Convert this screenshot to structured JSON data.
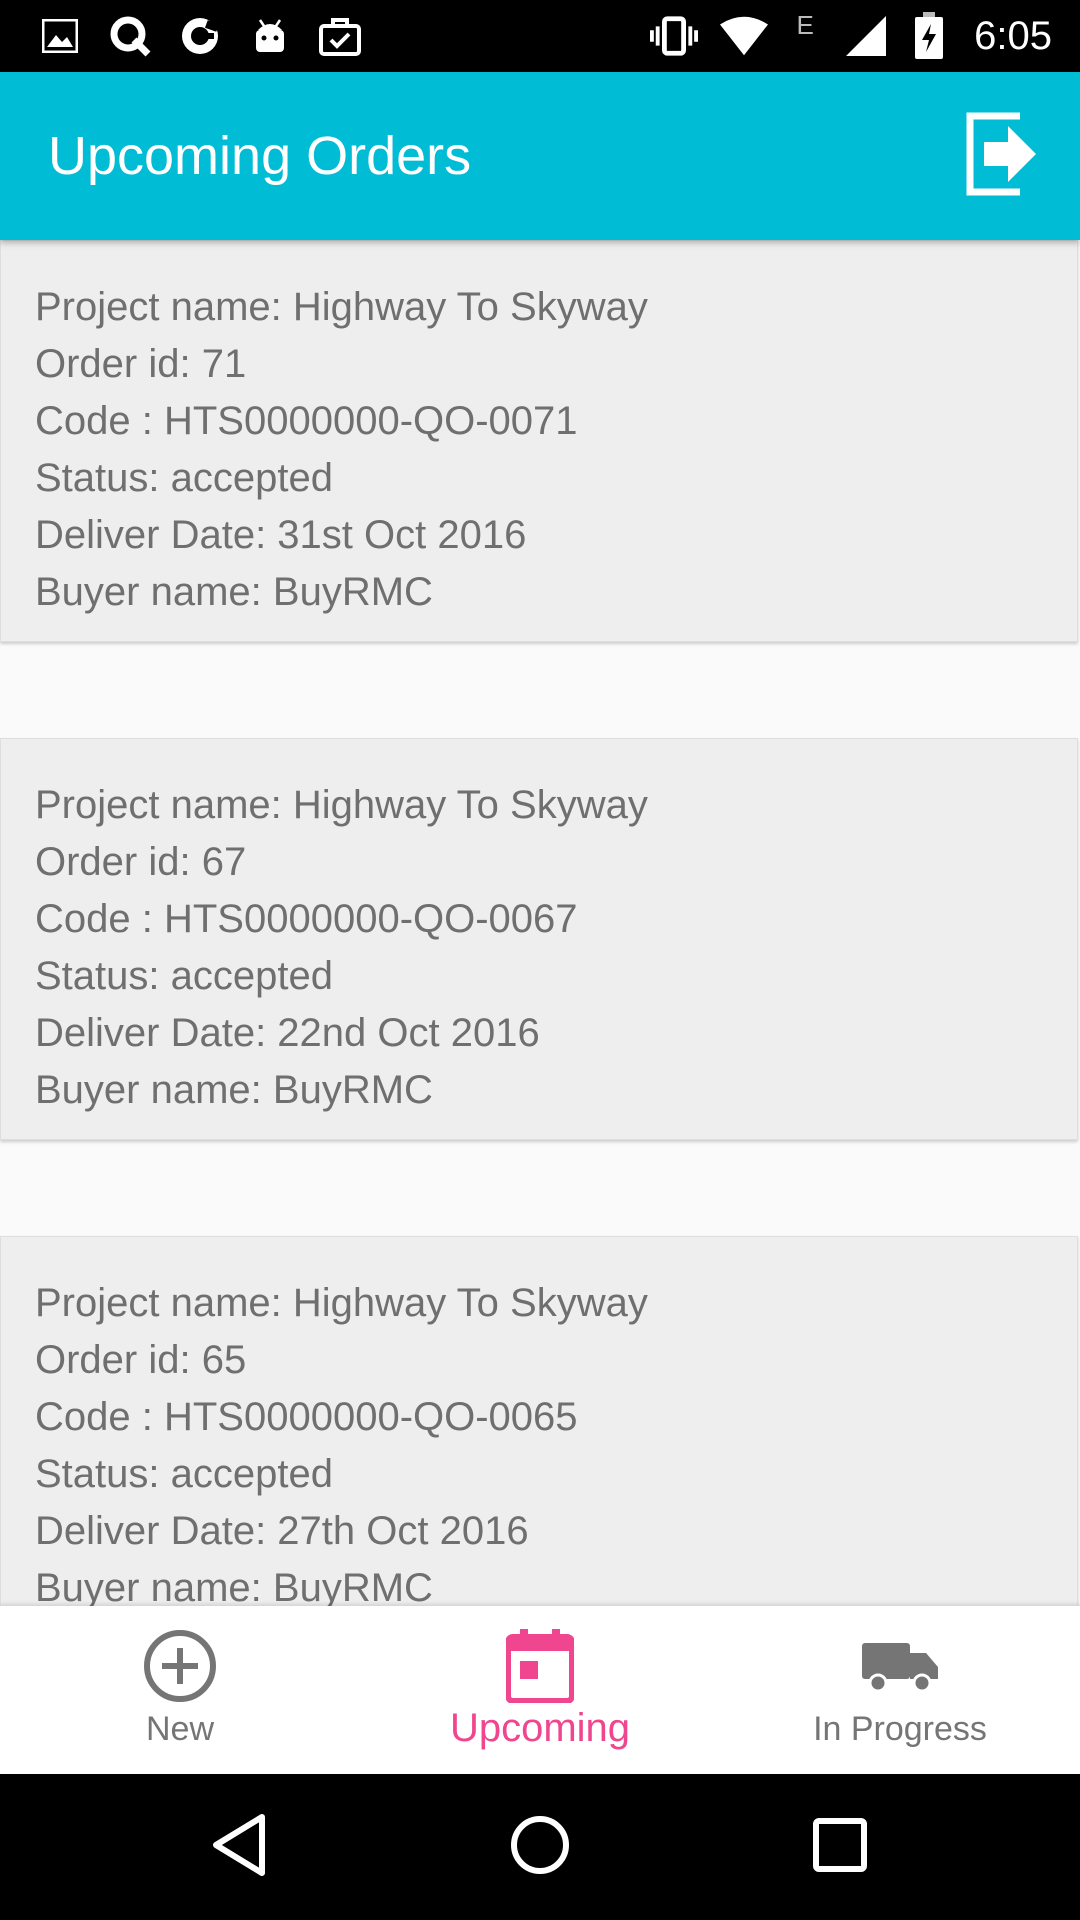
{
  "status_bar": {
    "left_icons": [
      "image-icon",
      "q-app-icon",
      "g-app-icon",
      "android-icon",
      "briefcase-check-icon"
    ],
    "right_icons": [
      "vibrate-icon",
      "wifi-icon",
      "network-e-icon",
      "signal-icon",
      "battery-charging-icon"
    ],
    "network_type": "E",
    "time": "6:05"
  },
  "app_bar": {
    "title": "Upcoming Orders",
    "logout_icon": "logout-icon",
    "accent_color": "#00BCD4"
  },
  "orders": [
    {
      "project": "Project name: Highway To Skyway",
      "order_id": "Order id: 71",
      "code": "Code : HTS0000000-QO-0071",
      "status": "Status: accepted",
      "deliver_date": "Deliver Date: 31st Oct 2016",
      "buyer": "Buyer name: BuyRMC"
    },
    {
      "project": "Project name: Highway To Skyway",
      "order_id": "Order id: 67",
      "code": "Code : HTS0000000-QO-0067",
      "status": "Status: accepted",
      "deliver_date": "Deliver Date: 22nd Oct 2016",
      "buyer": "Buyer name: BuyRMC"
    },
    {
      "project": "Project name: Highway To Skyway",
      "order_id": "Order id: 65",
      "code": "Code : HTS0000000-QO-0065",
      "status": "Status: accepted",
      "deliver_date": "Deliver Date: 27th Oct 2016",
      "buyer": "Buyer name: BuyRMC"
    }
  ],
  "bottom_nav": {
    "items": [
      {
        "label": "New",
        "icon": "add-circle-icon",
        "active": false
      },
      {
        "label": "Upcoming",
        "icon": "calendar-icon",
        "active": true
      },
      {
        "label": "In Progress",
        "icon": "truck-icon",
        "active": false
      }
    ],
    "active_color": "#f0468f"
  },
  "system_nav": {
    "icons": [
      "back-icon",
      "home-icon",
      "recents-icon"
    ]
  }
}
